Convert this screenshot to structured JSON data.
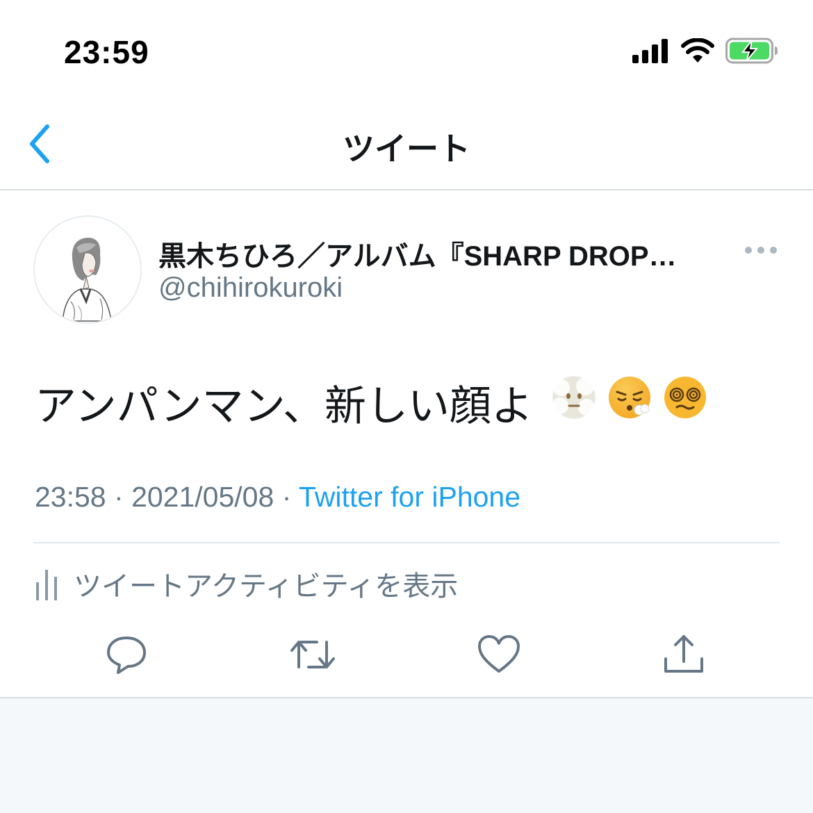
{
  "status_bar": {
    "time": "23:59",
    "icons": [
      "cellular-signal-icon",
      "wifi-icon",
      "battery-charging-icon"
    ],
    "battery_color": "#4cd964"
  },
  "nav": {
    "title": "ツイート",
    "back_icon": "chevron-left-icon",
    "accent_color": "#1da1f2"
  },
  "tweet": {
    "display_name": "黒木ちひろ／アルバム『SHARP DROP…",
    "handle": "@chihirokuroki",
    "text": "アンパンマン、新しい顔よ",
    "emojis": [
      "face-in-clouds-emoji",
      "face-exhaling-emoji",
      "face-with-spiral-eyes-emoji"
    ],
    "time": "23:58",
    "date": "2021/05/08",
    "separator": "·",
    "source": "Twitter for iPhone"
  },
  "activity": {
    "label": "ツイートアクティビティを表示",
    "icon": "bar-chart-icon"
  },
  "actions": [
    {
      "name": "reply-icon"
    },
    {
      "name": "retweet-icon"
    },
    {
      "name": "like-icon"
    },
    {
      "name": "share-icon"
    }
  ],
  "colors": {
    "text_primary": "#14171a",
    "text_secondary": "#657786",
    "link": "#1da1f2",
    "divider": "#e1e8ed",
    "bottom_background": "#f5f8fa"
  }
}
